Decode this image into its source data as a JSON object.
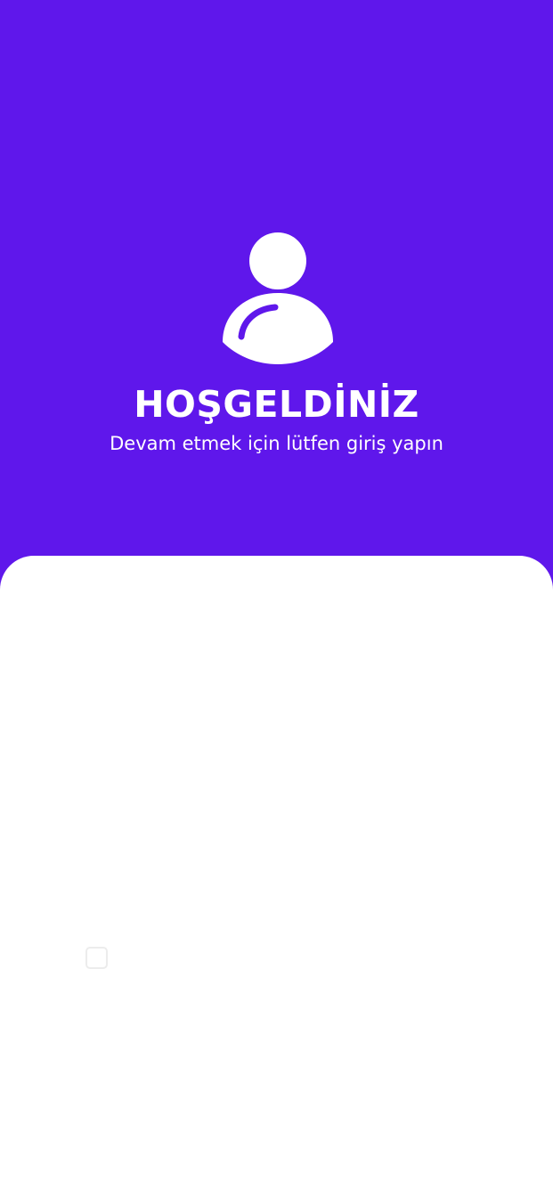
{
  "theme": {
    "primary": "#5F17EB",
    "surface": "#FFFFFF",
    "text_on_primary": "#FFFFFF"
  },
  "header": {
    "avatar_icon": "user-avatar-icon",
    "title": "HOŞGELDİNİZ",
    "subtitle": "Devam etmek için lütfen giriş yapın"
  },
  "login_card": {
    "remember_me_checked": false
  }
}
